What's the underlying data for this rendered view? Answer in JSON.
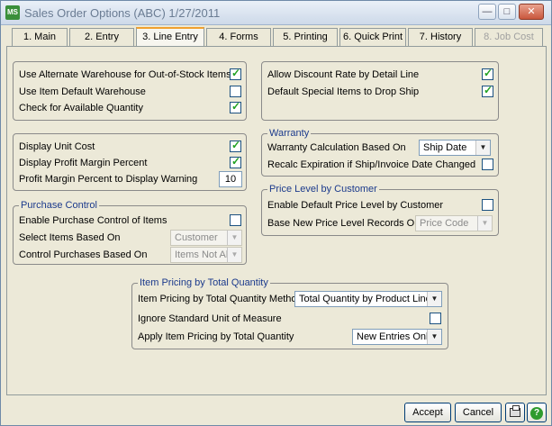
{
  "window": {
    "title": "Sales Order Options (ABC) 1/27/2011",
    "app_badge": "MS"
  },
  "tabs": [
    {
      "label": "1. Main",
      "active": false,
      "enabled": true
    },
    {
      "label": "2. Entry",
      "active": false,
      "enabled": true
    },
    {
      "label": "3. Line Entry",
      "active": true,
      "enabled": true
    },
    {
      "label": "4. Forms",
      "active": false,
      "enabled": true
    },
    {
      "label": "5. Printing",
      "active": false,
      "enabled": true
    },
    {
      "label": "6. Quick Print",
      "active": false,
      "enabled": true
    },
    {
      "label": "7. History",
      "active": false,
      "enabled": true
    },
    {
      "label": "8. Job Cost",
      "active": false,
      "enabled": false
    }
  ],
  "warehouse": {
    "alt_wh_label": "Use Alternate Warehouse for Out-of-Stock Items",
    "alt_wh_checked": true,
    "item_default_wh_label": "Use Item Default Warehouse",
    "item_default_wh_checked": false,
    "check_qty_label": "Check for Available Quantity",
    "check_qty_checked": true
  },
  "discount": {
    "allow_discount_label": "Allow Discount Rate by Detail Line",
    "allow_discount_checked": true,
    "drop_ship_label": "Default Special Items to Drop Ship",
    "drop_ship_checked": true
  },
  "cost": {
    "unit_cost_label": "Display Unit Cost",
    "unit_cost_checked": true,
    "profit_margin_label": "Display Profit Margin Percent",
    "profit_margin_checked": true,
    "warning_label": "Profit Margin Percent to Display Warning",
    "warning_value": "10"
  },
  "warranty": {
    "legend": "Warranty",
    "calc_label": "Warranty Calculation Based On",
    "calc_value": "Ship Date",
    "recalc_label": "Recalc Expiration if Ship/Invoice Date Changed",
    "recalc_checked": false
  },
  "purchase": {
    "legend": "Purchase Control",
    "enable_label": "Enable Purchase Control of Items",
    "enable_checked": false,
    "select_label": "Select Items Based On",
    "select_value": "Customer",
    "control_label": "Control Purchases Based On",
    "control_value": "Items Not Allowed"
  },
  "price_level": {
    "legend": "Price Level by Customer",
    "enable_label": "Enable Default Price Level by Customer",
    "enable_checked": false,
    "base_label": "Base New Price Level Records On",
    "base_value": "Price Code"
  },
  "item_pricing": {
    "legend": "Item Pricing by Total Quantity",
    "method_label": "Item Pricing by Total Quantity Method",
    "method_value": "Total Quantity by Product Line",
    "ignore_label": "Ignore Standard Unit of Measure",
    "ignore_checked": false,
    "apply_label": "Apply Item Pricing by Total Quantity",
    "apply_value": "New Entries Only"
  },
  "buttons": {
    "accept": "Accept",
    "cancel": "Cancel"
  },
  "colors": {
    "legend_text": "#1b3a8c",
    "check_mark": "#21a121",
    "active_tab_accent": "#f0a030"
  }
}
